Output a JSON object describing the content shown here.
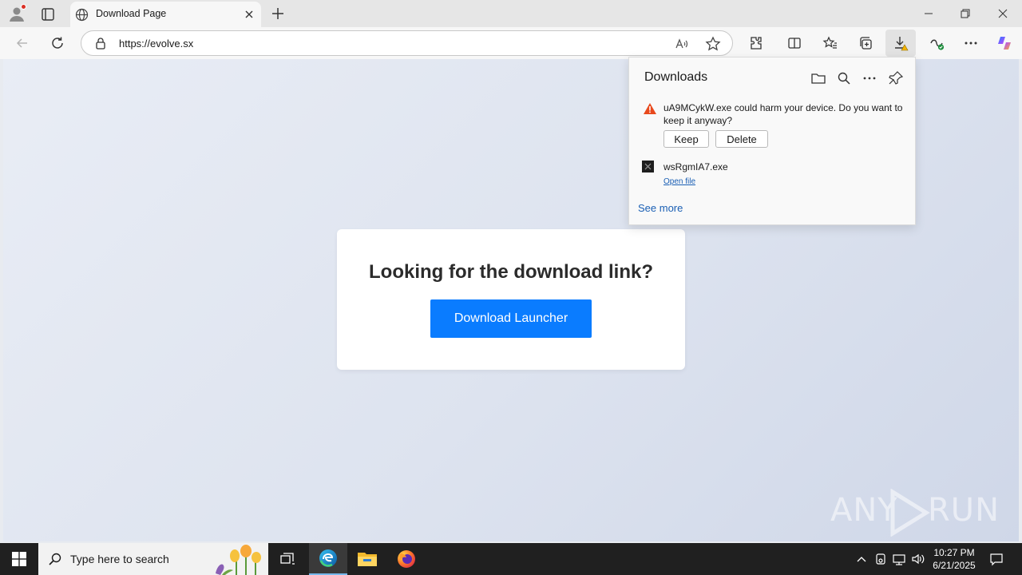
{
  "browser": {
    "tab_title": "Download Page",
    "url": "https://evolve.sx"
  },
  "page": {
    "heading": "Looking for the download link?",
    "button_label": "Download Launcher",
    "accent_color": "#0a7cff"
  },
  "downloads": {
    "title": "Downloads",
    "warning_text": "uA9MCykW.exe could harm your device. Do you want to keep it anyway?",
    "keep_label": "Keep",
    "delete_label": "Delete",
    "file_name": "wsRgmIA7.exe",
    "open_file_label": "Open file",
    "see_more_label": "See more"
  },
  "watermark": {
    "left_text": "ANY",
    "right_text": "RUN"
  },
  "taskbar": {
    "search_placeholder": "Type here to search",
    "time": "10:27 PM",
    "date": "6/21/2025"
  }
}
